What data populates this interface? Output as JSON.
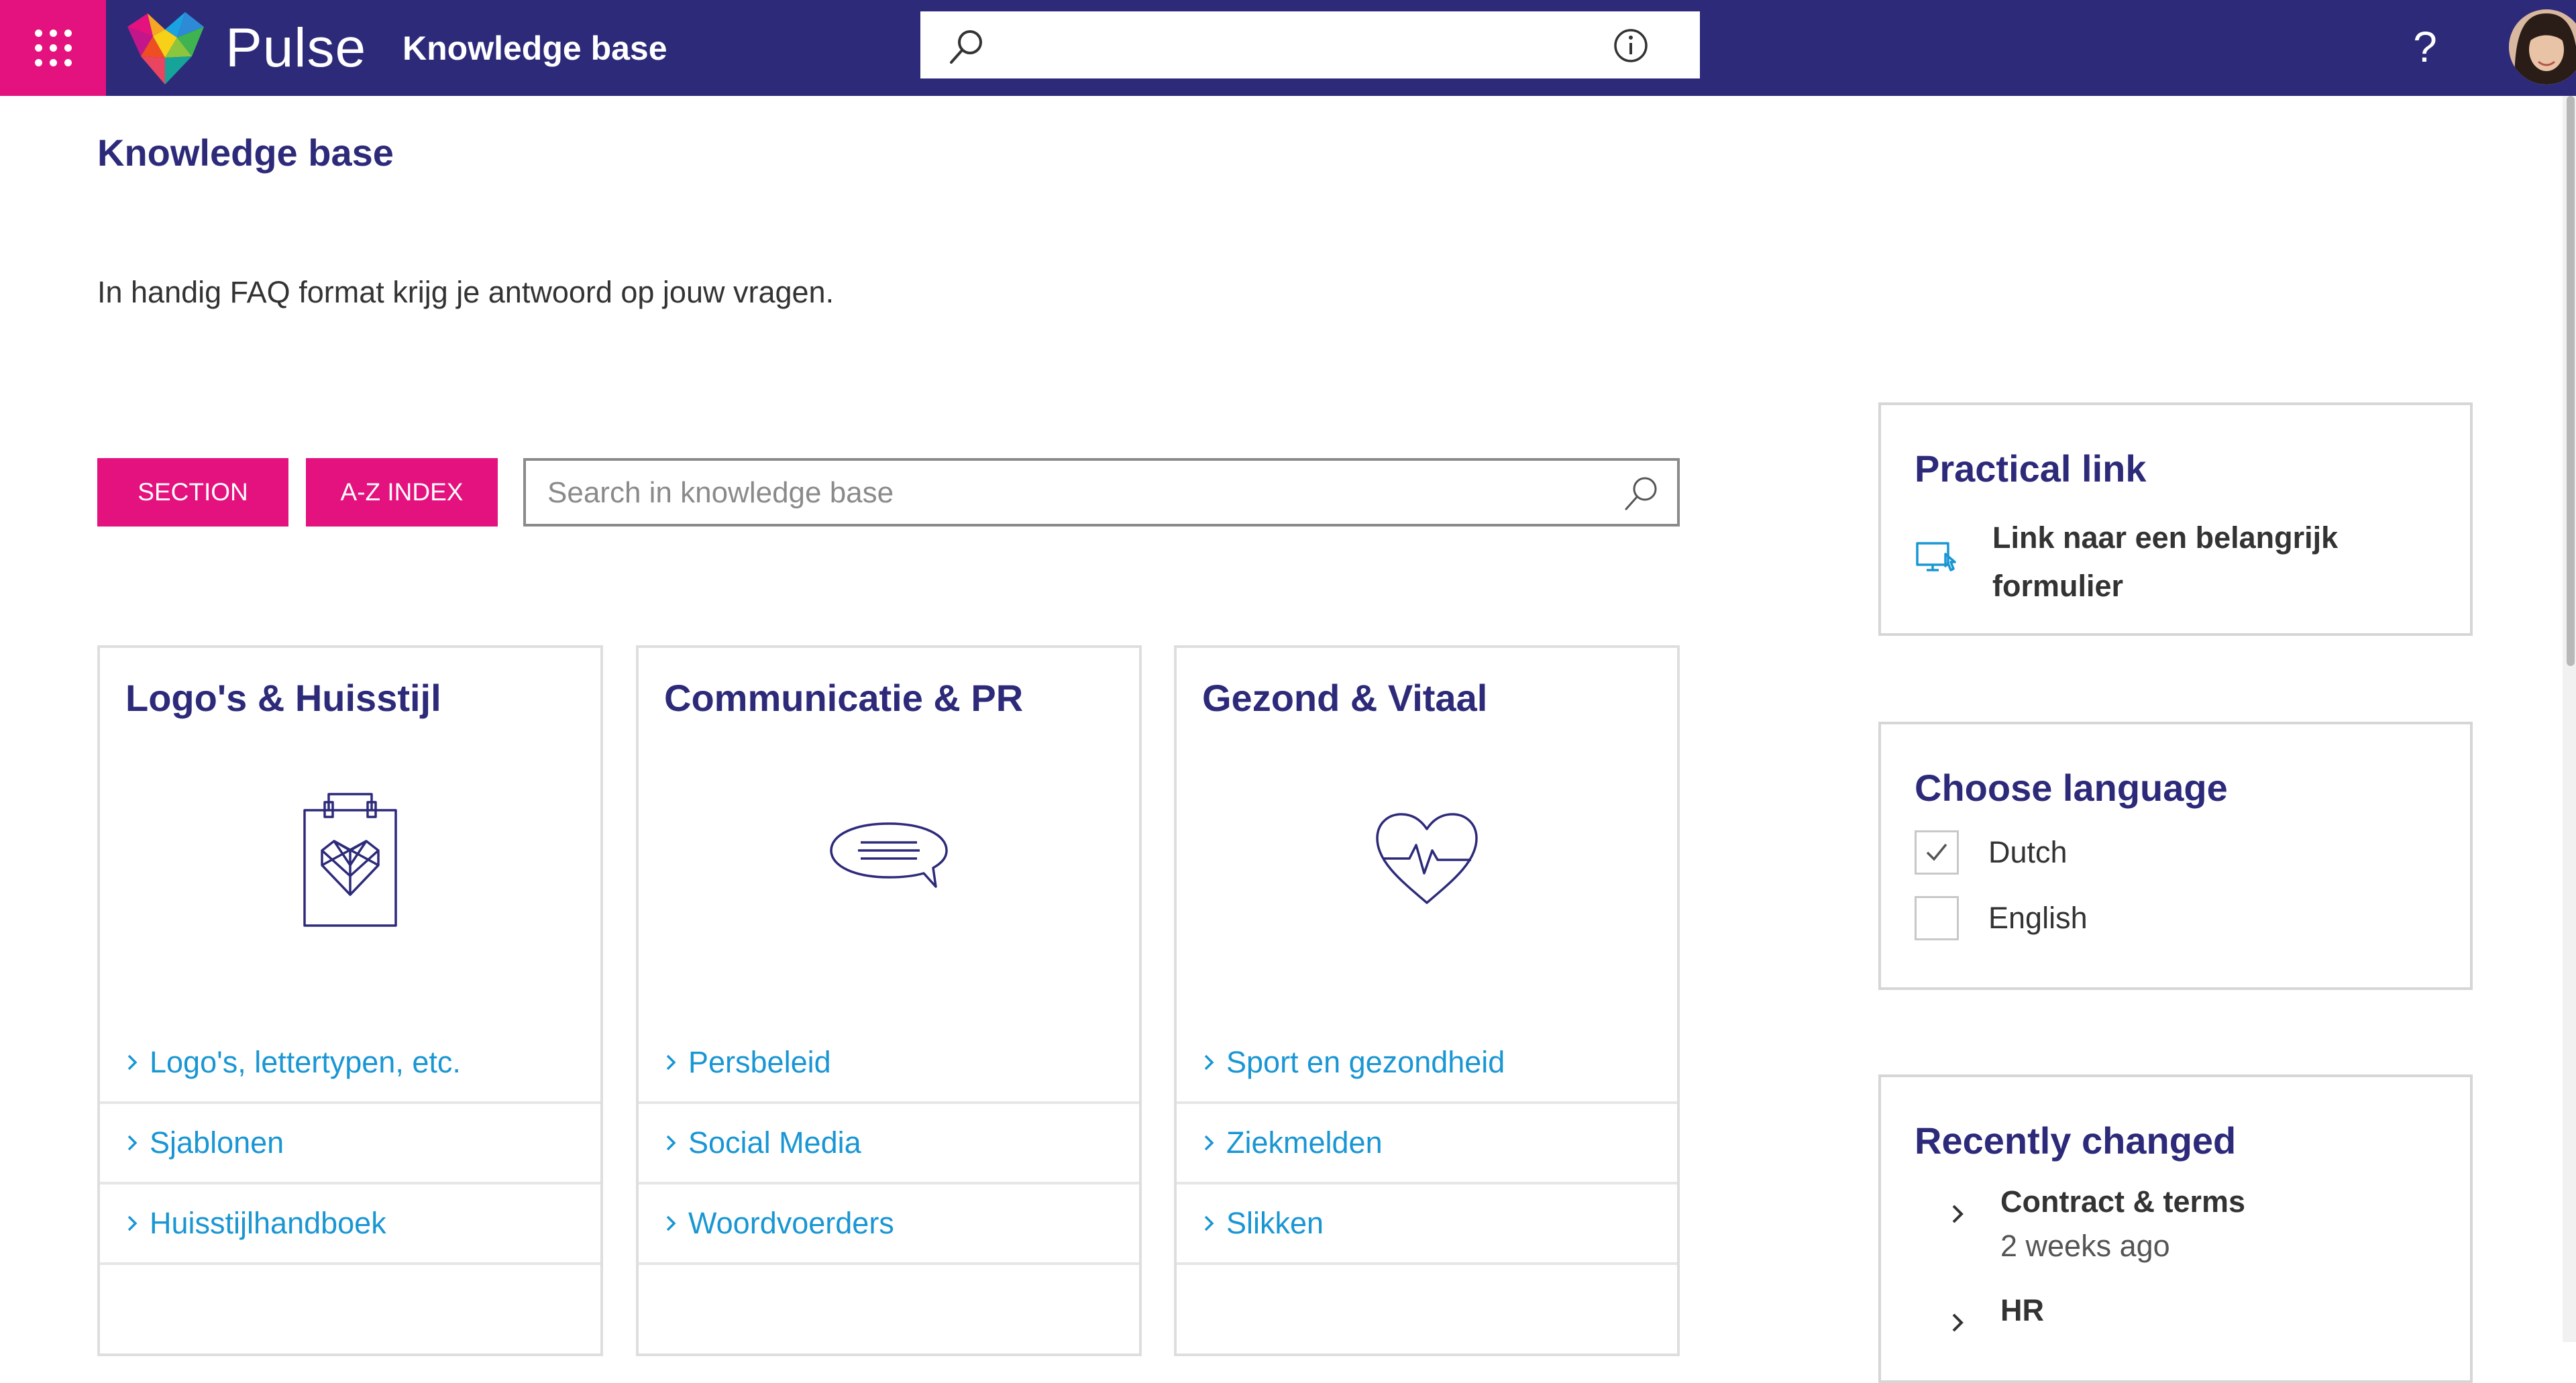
{
  "colors": {
    "header_bg": "#2d2a7a",
    "accent": "#e3127f",
    "link": "#1996d3",
    "title": "#2d2a7a"
  },
  "topbar": {
    "brand": "Pulse",
    "site_title": "Knowledge base",
    "search": {
      "value": "",
      "placeholder": ""
    },
    "help": "?"
  },
  "page": {
    "title": "Knowledge base",
    "intro": "In handig FAQ format krijg je antwoord op jouw vragen."
  },
  "toolbar": {
    "section_label": "SECTION",
    "az_label": "A-Z INDEX",
    "search_placeholder": "Search in knowledge base"
  },
  "cards": [
    {
      "title": "Logo's & Huisstijl",
      "icon": "shopping-bag-heart-icon",
      "links": [
        "Logo's, lettertypen, etc.",
        "Sjablonen",
        "Huisstijlhandboek"
      ]
    },
    {
      "title": "Communicatie & PR",
      "icon": "speech-bubble-icon",
      "links": [
        "Persbeleid",
        "Social Media",
        "Woordvoerders"
      ]
    },
    {
      "title": "Gezond & Vitaal",
      "icon": "heart-pulse-icon",
      "links": [
        "Sport en gezondheid",
        "Ziekmelden",
        "Slikken"
      ]
    }
  ],
  "practical": {
    "title": "Practical link",
    "link": {
      "label": "Link naar een belangrijk formulier",
      "icon": "monitor-click-icon"
    }
  },
  "language": {
    "title": "Choose language",
    "options": [
      {
        "label": "Dutch",
        "checked": true
      },
      {
        "label": "English",
        "checked": false
      }
    ]
  },
  "recent": {
    "title": "Recently changed",
    "items": [
      {
        "title": "Contract & terms",
        "time": "2 weeks ago"
      },
      {
        "title": "HR",
        "time": ""
      }
    ]
  }
}
